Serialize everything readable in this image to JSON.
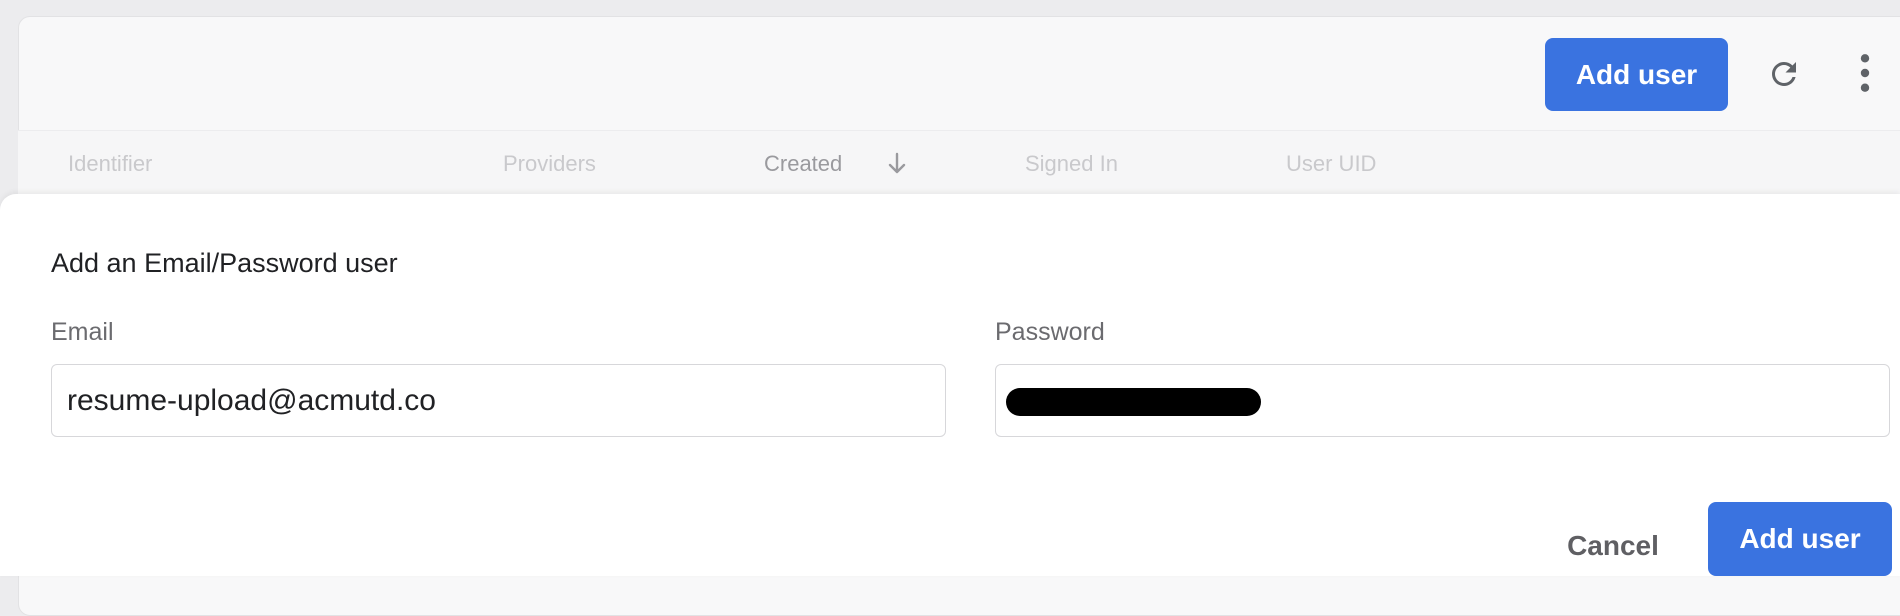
{
  "toolbar": {
    "add_user_label": "Add user",
    "refresh_icon": "refresh-icon",
    "more_icon": "more-vert-icon"
  },
  "table": {
    "columns": [
      "Identifier",
      "Providers",
      "Created",
      "Signed In",
      "User UID"
    ],
    "sorted_column": "Created",
    "sort_direction": "descending"
  },
  "dialog": {
    "title": "Add an Email/Password user",
    "email": {
      "label": "Email",
      "value": "resume-upload@acmutd.co"
    },
    "password": {
      "label": "Password",
      "redacted": true
    },
    "cancel_label": "Cancel",
    "submit_label": "Add user"
  },
  "colors": {
    "primary": "#3a73e0",
    "background": "#ececee",
    "card": "#f8f8f9"
  }
}
